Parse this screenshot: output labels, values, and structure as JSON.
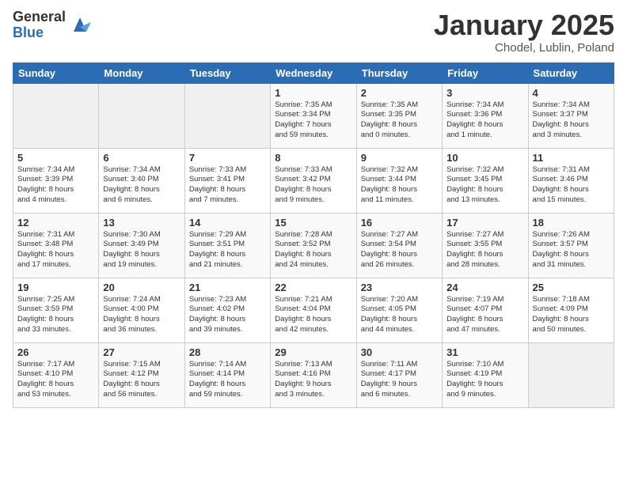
{
  "header": {
    "logo_general": "General",
    "logo_blue": "Blue",
    "month_title": "January 2025",
    "location": "Chodel, Lublin, Poland"
  },
  "weekdays": [
    "Sunday",
    "Monday",
    "Tuesday",
    "Wednesday",
    "Thursday",
    "Friday",
    "Saturday"
  ],
  "weeks": [
    [
      {
        "day": "",
        "info": ""
      },
      {
        "day": "",
        "info": ""
      },
      {
        "day": "",
        "info": ""
      },
      {
        "day": "1",
        "info": "Sunrise: 7:35 AM\nSunset: 3:34 PM\nDaylight: 7 hours\nand 59 minutes."
      },
      {
        "day": "2",
        "info": "Sunrise: 7:35 AM\nSunset: 3:35 PM\nDaylight: 8 hours\nand 0 minutes."
      },
      {
        "day": "3",
        "info": "Sunrise: 7:34 AM\nSunset: 3:36 PM\nDaylight: 8 hours\nand 1 minute."
      },
      {
        "day": "4",
        "info": "Sunrise: 7:34 AM\nSunset: 3:37 PM\nDaylight: 8 hours\nand 3 minutes."
      }
    ],
    [
      {
        "day": "5",
        "info": "Sunrise: 7:34 AM\nSunset: 3:39 PM\nDaylight: 8 hours\nand 4 minutes."
      },
      {
        "day": "6",
        "info": "Sunrise: 7:34 AM\nSunset: 3:40 PM\nDaylight: 8 hours\nand 6 minutes."
      },
      {
        "day": "7",
        "info": "Sunrise: 7:33 AM\nSunset: 3:41 PM\nDaylight: 8 hours\nand 7 minutes."
      },
      {
        "day": "8",
        "info": "Sunrise: 7:33 AM\nSunset: 3:42 PM\nDaylight: 8 hours\nand 9 minutes."
      },
      {
        "day": "9",
        "info": "Sunrise: 7:32 AM\nSunset: 3:44 PM\nDaylight: 8 hours\nand 11 minutes."
      },
      {
        "day": "10",
        "info": "Sunrise: 7:32 AM\nSunset: 3:45 PM\nDaylight: 8 hours\nand 13 minutes."
      },
      {
        "day": "11",
        "info": "Sunrise: 7:31 AM\nSunset: 3:46 PM\nDaylight: 8 hours\nand 15 minutes."
      }
    ],
    [
      {
        "day": "12",
        "info": "Sunrise: 7:31 AM\nSunset: 3:48 PM\nDaylight: 8 hours\nand 17 minutes."
      },
      {
        "day": "13",
        "info": "Sunrise: 7:30 AM\nSunset: 3:49 PM\nDaylight: 8 hours\nand 19 minutes."
      },
      {
        "day": "14",
        "info": "Sunrise: 7:29 AM\nSunset: 3:51 PM\nDaylight: 8 hours\nand 21 minutes."
      },
      {
        "day": "15",
        "info": "Sunrise: 7:28 AM\nSunset: 3:52 PM\nDaylight: 8 hours\nand 24 minutes."
      },
      {
        "day": "16",
        "info": "Sunrise: 7:27 AM\nSunset: 3:54 PM\nDaylight: 8 hours\nand 26 minutes."
      },
      {
        "day": "17",
        "info": "Sunrise: 7:27 AM\nSunset: 3:55 PM\nDaylight: 8 hours\nand 28 minutes."
      },
      {
        "day": "18",
        "info": "Sunrise: 7:26 AM\nSunset: 3:57 PM\nDaylight: 8 hours\nand 31 minutes."
      }
    ],
    [
      {
        "day": "19",
        "info": "Sunrise: 7:25 AM\nSunset: 3:59 PM\nDaylight: 8 hours\nand 33 minutes."
      },
      {
        "day": "20",
        "info": "Sunrise: 7:24 AM\nSunset: 4:00 PM\nDaylight: 8 hours\nand 36 minutes."
      },
      {
        "day": "21",
        "info": "Sunrise: 7:23 AM\nSunset: 4:02 PM\nDaylight: 8 hours\nand 39 minutes."
      },
      {
        "day": "22",
        "info": "Sunrise: 7:21 AM\nSunset: 4:04 PM\nDaylight: 8 hours\nand 42 minutes."
      },
      {
        "day": "23",
        "info": "Sunrise: 7:20 AM\nSunset: 4:05 PM\nDaylight: 8 hours\nand 44 minutes."
      },
      {
        "day": "24",
        "info": "Sunrise: 7:19 AM\nSunset: 4:07 PM\nDaylight: 8 hours\nand 47 minutes."
      },
      {
        "day": "25",
        "info": "Sunrise: 7:18 AM\nSunset: 4:09 PM\nDaylight: 8 hours\nand 50 minutes."
      }
    ],
    [
      {
        "day": "26",
        "info": "Sunrise: 7:17 AM\nSunset: 4:10 PM\nDaylight: 8 hours\nand 53 minutes."
      },
      {
        "day": "27",
        "info": "Sunrise: 7:15 AM\nSunset: 4:12 PM\nDaylight: 8 hours\nand 56 minutes."
      },
      {
        "day": "28",
        "info": "Sunrise: 7:14 AM\nSunset: 4:14 PM\nDaylight: 8 hours\nand 59 minutes."
      },
      {
        "day": "29",
        "info": "Sunrise: 7:13 AM\nSunset: 4:16 PM\nDaylight: 9 hours\nand 3 minutes."
      },
      {
        "day": "30",
        "info": "Sunrise: 7:11 AM\nSunset: 4:17 PM\nDaylight: 9 hours\nand 6 minutes."
      },
      {
        "day": "31",
        "info": "Sunrise: 7:10 AM\nSunset: 4:19 PM\nDaylight: 9 hours\nand 9 minutes."
      },
      {
        "day": "",
        "info": ""
      }
    ]
  ]
}
